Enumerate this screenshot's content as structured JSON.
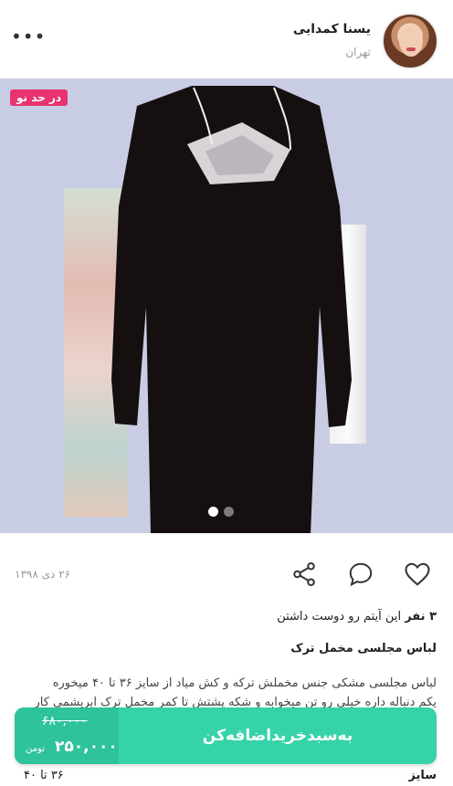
{
  "seller": {
    "name": "یسنا کمدایی",
    "city": "تهران",
    "more_icon": "more-horizontal-icon"
  },
  "product": {
    "badge": "در حد نو",
    "image_count": 2,
    "active_image": 1,
    "date": "۲۶ دی ۱۳۹۸",
    "likes_count": "۳ نفر",
    "likes_text": "این آیتم رو دوست داشتن",
    "title": "لباس مجلسی مخمل ترک",
    "description": [
      "لباس مجلسی مشکی جنس مخملش ترکه و کش میاد از سایز ۳۶ تا ۴۰ میخوره",
      "یکم دنباله داره خیلی رو تن میخوابه و شکه پشتش تا کمر مخمل ترک ابریشمی کار"
    ],
    "size_label": "سایز",
    "size_value": "۳۶ تا ۴۰"
  },
  "icons": {
    "like": "heart-icon",
    "comment": "comment-icon",
    "share": "share-icon"
  },
  "cart": {
    "label": "به‌سبدخریداضافه‌کن",
    "old_price": "۶۸۰,۰۰۰",
    "new_price": "۲۵۰,۰۰۰",
    "currency": "تومن"
  },
  "colors": {
    "accent_green": "#36d3a9",
    "badge_pink": "#e8336f"
  }
}
